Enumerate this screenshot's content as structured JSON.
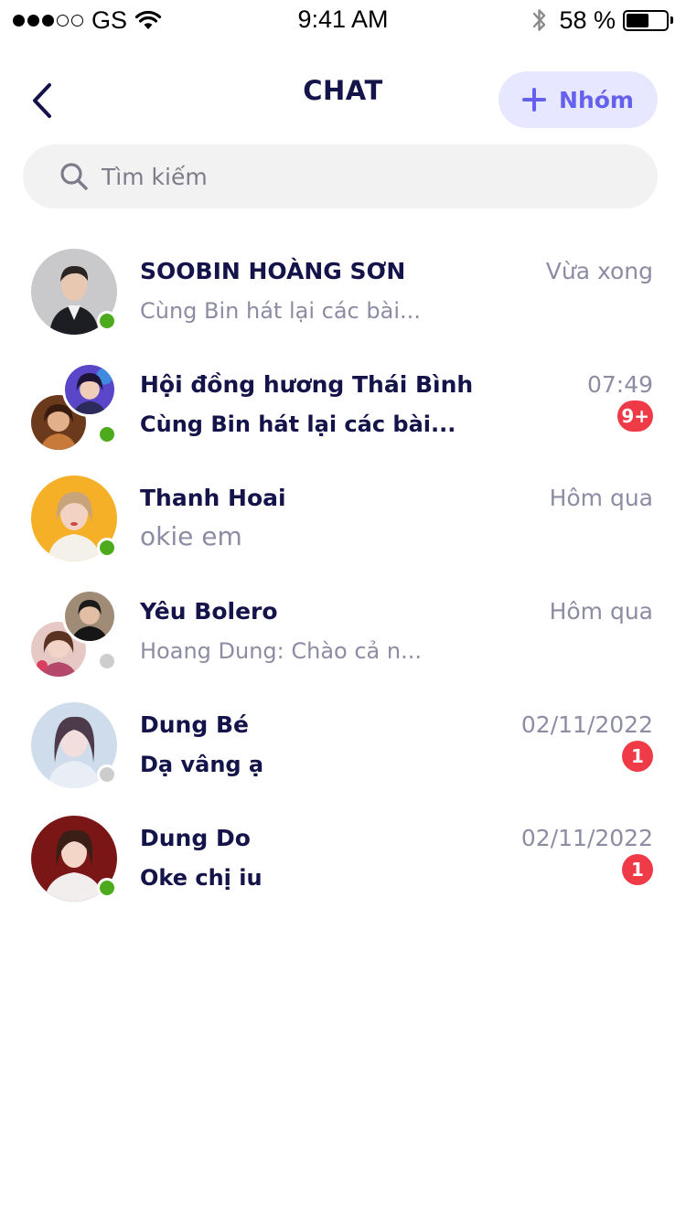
{
  "status_bar": {
    "carrier": "GS",
    "time": "9:41 AM",
    "battery_percent": "58 %",
    "battery_level": 0.58
  },
  "header": {
    "title": "CHAT",
    "group_button_label": "Nhóm"
  },
  "search": {
    "placeholder": "Tìm kiếm"
  },
  "colors": {
    "accent": "#6561ee",
    "accent_bg": "#e7e8ff",
    "online": "#4caa1c",
    "offline": "#cdcdcd",
    "badge": "#ee3b47",
    "text_primary": "#14134a",
    "text_secondary": "#8c8ca3"
  },
  "chats": [
    {
      "name": "SOOBIN HOÀNG SƠN",
      "preview": "Cùng Bin hát lại các bài...",
      "time": "Vừa xong",
      "badge": "",
      "online": true,
      "group": false,
      "unread": false
    },
    {
      "name": "Hội đồng hương Thái Bình",
      "preview": "Cùng Bin hát lại các bài...",
      "time": "07:49",
      "badge": "9+",
      "online": true,
      "group": true,
      "unread": true
    },
    {
      "name": "Thanh Hoai",
      "preview": "okie em",
      "time": "Hôm qua",
      "badge": "",
      "online": true,
      "group": false,
      "unread": false
    },
    {
      "name": "Yêu Bolero",
      "preview": "Hoang Dung: Chào cả n...",
      "time": "Hôm qua",
      "badge": "",
      "online": false,
      "group": true,
      "unread": false
    },
    {
      "name": "Dung Bé",
      "preview": "Dạ vâng ạ",
      "time": "02/11/2022",
      "badge": "1",
      "online": false,
      "group": false,
      "unread": true
    },
    {
      "name": "Dung Do",
      "preview": "Oke chị iu",
      "time": "02/11/2022",
      "badge": "1",
      "online": true,
      "group": false,
      "unread": true
    }
  ]
}
